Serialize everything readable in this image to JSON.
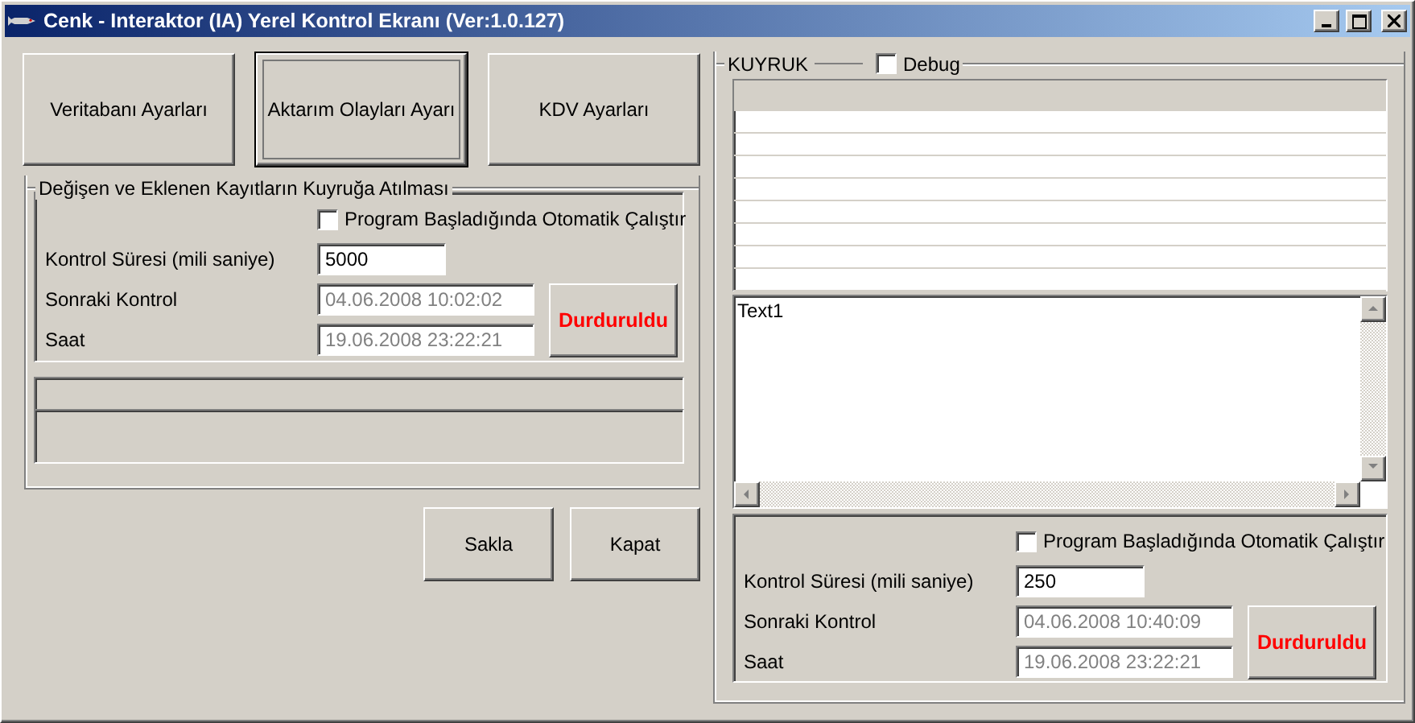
{
  "window": {
    "title": "Cenk - Interaktor (IA) Yerel Kontrol Ekranı (Ver:1.0.127)"
  },
  "top_buttons": [
    {
      "label": "Veritabanı Ayarları",
      "focused": false
    },
    {
      "label": "Aktarım Olayları Ayarı",
      "focused": true
    },
    {
      "label": "KDV Ayarları",
      "focused": false
    }
  ],
  "transfer_group": {
    "title": "Değişen ve Eklenen Kayıtların Kuyruğa Atılması",
    "monitor": {
      "autostart": {
        "label": "Program Başladığında Otomatik Çalıştır",
        "checked": false
      },
      "fields": [
        {
          "label": "Kontrol Süresi (mili saniye)",
          "value": "5000",
          "disabled": false
        },
        {
          "label": "Sonraki Kontrol",
          "value": "04.06.2008 10:02:02",
          "disabled": true
        },
        {
          "label": "Saat",
          "value": "19.06.2008 23:22:21",
          "disabled": true
        }
      ],
      "status_button": "Durduruldu"
    }
  },
  "action_buttons": [
    {
      "label": "Sakla"
    },
    {
      "label": "Kapat"
    }
  ],
  "queue_group": {
    "title": "KUYRUK",
    "debug": {
      "label": "Debug",
      "checked": false
    },
    "log": {
      "value": "Text1"
    },
    "monitor": {
      "autostart": {
        "label": "Program Başladığında Otomatik Çalıştır",
        "checked": false
      },
      "fields": [
        {
          "label": "Kontrol Süresi (mili saniye)",
          "value": "250",
          "disabled": false
        },
        {
          "label": "Sonraki Kontrol",
          "value": "04.06.2008 10:40:09",
          "disabled": true
        },
        {
          "label": "Saat",
          "value": "19.06.2008 23:22:21",
          "disabled": true
        }
      ],
      "status_button": "Durduruldu"
    }
  }
}
